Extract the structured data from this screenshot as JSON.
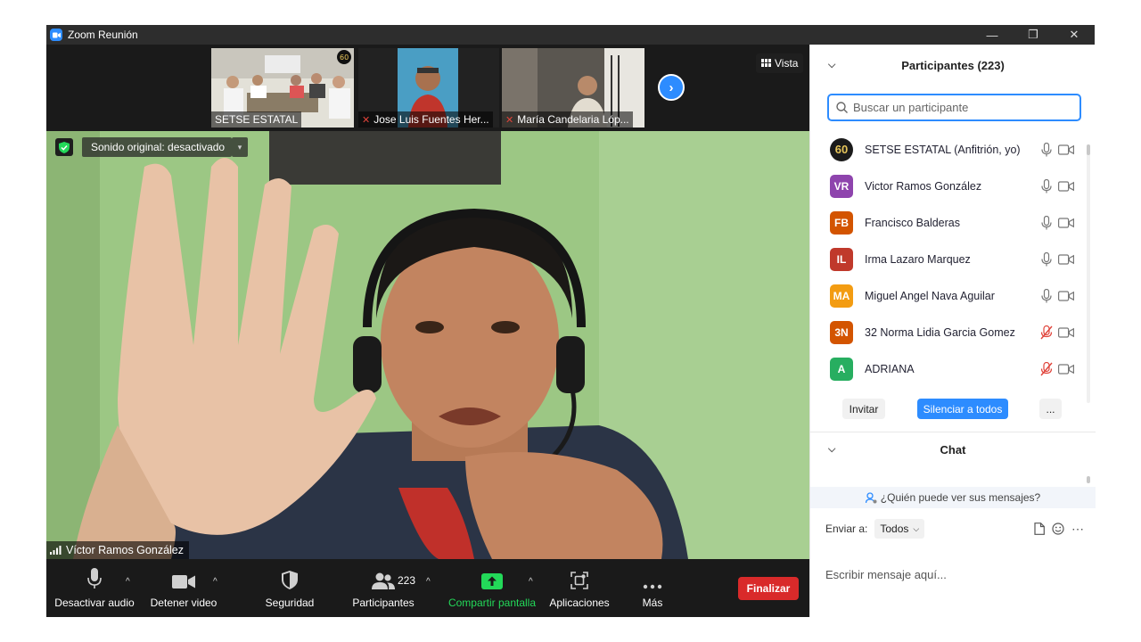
{
  "window": {
    "title": "Zoom Reunión",
    "controls": [
      "—",
      "❐",
      "✕"
    ]
  },
  "strip": {
    "thumbnails": [
      {
        "name": "SETSE ESTATAL",
        "muted": false
      },
      {
        "name": "Jose Luis Fuentes Her...",
        "muted": true
      },
      {
        "name": "María Candelaria Lóp...",
        "muted": true
      }
    ],
    "view_label": "Vista"
  },
  "video": {
    "sound_label": "Sonido original: desactivado",
    "speaker_name": "Víctor Ramos González"
  },
  "toolbar": {
    "audio_label": "Desactivar audio",
    "video_label": "Detener video",
    "security_label": "Seguridad",
    "participants_label": "Participantes",
    "participants_count": "223",
    "share_label": "Compartir pantalla",
    "apps_label": "Aplicaciones",
    "more_label": "Más",
    "end_label": "Finalizar"
  },
  "panel": {
    "title": "Participantes (223)",
    "search_placeholder": "Buscar un participante",
    "participants": [
      {
        "initials": "60",
        "name": "SETSE ESTATAL (Anfitrión, yo)",
        "color": "#1b1b1b",
        "mic_muted": false
      },
      {
        "initials": "VR",
        "name": "Victor Ramos González",
        "color": "#8e44ad",
        "mic_muted": false
      },
      {
        "initials": "FB",
        "name": "Francisco Balderas",
        "color": "#d35400",
        "mic_muted": false
      },
      {
        "initials": "IL",
        "name": "Irma Lazaro Marquez",
        "color": "#c0392b",
        "mic_muted": false
      },
      {
        "initials": "MA",
        "name": "Miguel Angel Nava Aguilar",
        "color": "#f39c12",
        "mic_muted": false
      },
      {
        "initials": "3N",
        "name": "32 Norma Lidia Garcia Gomez",
        "color": "#d35400",
        "mic_muted": true
      },
      {
        "initials": "A",
        "name": "ADRIANA",
        "color": "#27ae60",
        "mic_muted": true
      }
    ],
    "invite_label": "Invitar",
    "mute_all_label": "Silenciar a todos",
    "more_label": "...",
    "chat_title": "Chat",
    "who_can_see": "¿Quién puede ver sus mensajes?",
    "send_to_label": "Enviar a:",
    "send_to_value": "Todos",
    "message_placeholder": "Escribir mensaje aquí..."
  },
  "colors": {
    "accent": "#2d8cff",
    "end_red": "#d92a2a",
    "share_green": "#23d959",
    "muted_red": "#e0433a"
  }
}
